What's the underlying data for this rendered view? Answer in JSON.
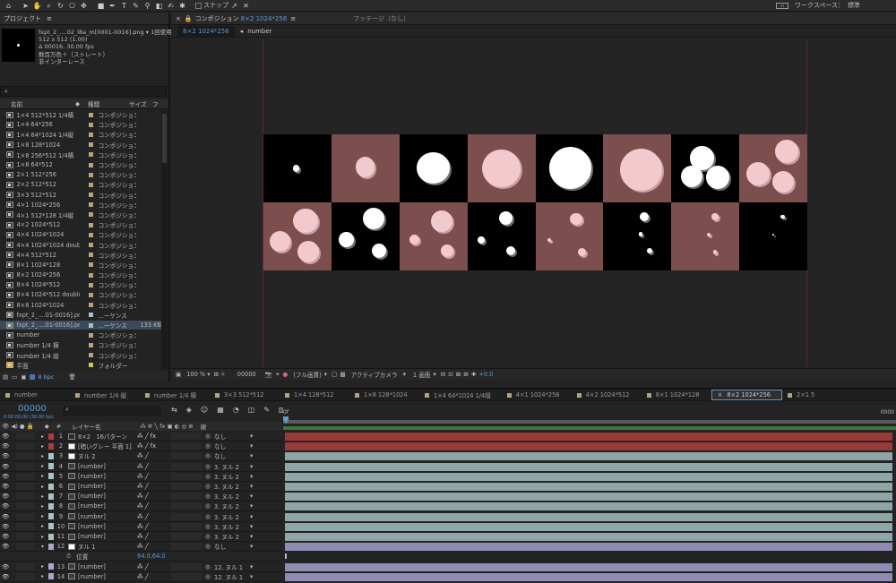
{
  "toolbar": {
    "snap_label": "スナップ",
    "workspace_label": "ワークスペース：",
    "workspace_value": "標準",
    "tools": [
      "home-icon",
      "select-icon",
      "hand-icon",
      "zoom-icon",
      "rotate-icon",
      "camera-icon",
      "pan-icon",
      "rect-icon",
      "pen-icon",
      "text-icon",
      "brush-icon",
      "stamp-icon",
      "eraser-icon",
      "roto-icon",
      "puppet-icon"
    ]
  },
  "project": {
    "tab_label": "プロジェクト",
    "preview": {
      "filename": "fxpt_2_....02_l8a_m[0001-0016].png ▾",
      "usage": "1回使用",
      "size": "512 x 512 (1.00)",
      "duration": "Δ 00016, 30.00 fps",
      "color": "数百万色＋（ストレート）",
      "interlace": "非インターレース"
    },
    "columns": {
      "name": "名前",
      "type": "種類",
      "size": "サイズ",
      "extra": "フ"
    },
    "items": [
      {
        "name": "1×4 512*512 1/4横",
        "type": "コンポジション",
        "size": "",
        "color": "#b8a37a",
        "icon": "comp"
      },
      {
        "name": "1×4 64*256",
        "type": "コンポジション",
        "size": "",
        "color": "#b8a37a",
        "icon": "comp"
      },
      {
        "name": "1×4 64*1024 1/4縦",
        "type": "コンポジション",
        "size": "",
        "color": "#b8a37a",
        "icon": "comp"
      },
      {
        "name": "1×8 128*1024",
        "type": "コンポジション",
        "size": "",
        "color": "#b8a37a",
        "icon": "comp"
      },
      {
        "name": "1×8 256*512 1/4横",
        "type": "コンポジション",
        "size": "",
        "color": "#b8a37a",
        "icon": "comp"
      },
      {
        "name": "1×8 64*512",
        "type": "コンポジション",
        "size": "",
        "color": "#b8a37a",
        "icon": "comp"
      },
      {
        "name": "2×1 512*256",
        "type": "コンポジション",
        "size": "",
        "color": "#b8a37a",
        "icon": "comp"
      },
      {
        "name": "2×2 512*512",
        "type": "コンポジション",
        "size": "",
        "color": "#b8a37a",
        "icon": "comp"
      },
      {
        "name": "3×3 512*512",
        "type": "コンポジション",
        "size": "",
        "color": "#b8a37a",
        "icon": "comp"
      },
      {
        "name": "4×1 1024*256",
        "type": "コンポジション",
        "size": "",
        "color": "#b8a37a",
        "icon": "comp"
      },
      {
        "name": "4×1 512*128 1/4縦",
        "type": "コンポジション",
        "size": "",
        "color": "#b8a37a",
        "icon": "comp"
      },
      {
        "name": "4×2 1024*512",
        "type": "コンポジション",
        "size": "",
        "color": "#b8a37a",
        "icon": "comp"
      },
      {
        "name": "4×4 1024*1024",
        "type": "コンポジション",
        "size": "",
        "color": "#b8a37a",
        "icon": "comp"
      },
      {
        "name": "4×4 1024*1024 double",
        "type": "コンポジション",
        "size": "",
        "color": "#b8a37a",
        "icon": "comp"
      },
      {
        "name": "4×4 512*512",
        "type": "コンポジション",
        "size": "",
        "color": "#b8a37a",
        "icon": "comp"
      },
      {
        "name": "8×1 1024*128",
        "type": "コンポジション",
        "size": "",
        "color": "#b8a37a",
        "icon": "comp"
      },
      {
        "name": "8×2 1024*256",
        "type": "コンポジション",
        "size": "",
        "color": "#b8a37a",
        "icon": "comp"
      },
      {
        "name": "8×4 1024*512",
        "type": "コンポジション",
        "size": "",
        "color": "#b8a37a",
        "icon": "comp"
      },
      {
        "name": "8×4 1024*512 double",
        "type": "コンポジション",
        "size": "",
        "color": "#b8a37a",
        "icon": "comp"
      },
      {
        "name": "8×8 1024*1024",
        "type": "コンポジション",
        "size": "",
        "color": "#b8a37a",
        "icon": "comp"
      },
      {
        "name": "fxpt_2_....01-0016].png",
        "type": "...ーケンス",
        "size": "",
        "color": "#9dc7c7",
        "icon": "seq"
      },
      {
        "name": "fxpt_2_....01-0016].png",
        "type": "...ーケンス",
        "size": "133 KB",
        "color": "#9dc7c7",
        "icon": "seq"
      },
      {
        "name": "number",
        "type": "コンポジション",
        "size": "",
        "color": "#b8a37a",
        "icon": "comp"
      },
      {
        "name": "number 1/4 横",
        "type": "コンポジション",
        "size": "",
        "color": "#b8a37a",
        "icon": "comp"
      },
      {
        "name": "number 1/4 縦",
        "type": "コンポジション",
        "size": "",
        "color": "#b8a37a",
        "icon": "comp"
      },
      {
        "name": "平面",
        "type": "フォルダー",
        "size": "",
        "color": "#d6c444",
        "icon": "folder"
      }
    ],
    "bpc": "8 bpc"
  },
  "comp": {
    "tab_label": "コンポジション",
    "tab_name": "8×2 1024*256",
    "footage_label": "フッテージ（なし）",
    "sub_tabs": [
      "8×2 1024*256",
      "number"
    ],
    "zoom": "100 %",
    "timecode": "00000",
    "quality": "(フル画質)",
    "camera": "アクティブカメラ",
    "views": "1 画面",
    "exposure": "+0.0"
  },
  "timeline": {
    "tabs": [
      "number",
      "number 1/4 縦",
      "number 1/4 横",
      "3×3 512*512",
      "1×4 128*512",
      "1×8 128*1024",
      "1×4 64*1024 1/4縦",
      "4×1 1024*256",
      "4×2 1024*512",
      "8×1 1024*128",
      "8×2 1024*256",
      "2×1 5"
    ],
    "active_tab": 10,
    "timecode": "00000",
    "timecode_sub": "0:00:00:00 (30.00 fps)",
    "col_layer_name": "レイヤー名",
    "col_parent": "親",
    "ruler_start": "0f",
    "ruler_end": "0000",
    "layers": [
      {
        "num": "1",
        "name": "8×2　16パターン",
        "parent": "なし",
        "label": "#b43a3a",
        "bar": "#9c3838",
        "fx": true
      },
      {
        "num": "2",
        "name": "[暗いグレー 平面 1]",
        "parent": "なし",
        "label": "#b43a3a",
        "bar": "#9c3838",
        "fx": true
      },
      {
        "num": "3",
        "name": "ヌル 2",
        "parent": "なし",
        "label": "#a9c4c4",
        "bar": "#8ea6a6",
        "fx": false
      },
      {
        "num": "4",
        "name": "[number]",
        "parent": "3. ヌル 2",
        "label": "#a9c4c4",
        "bar": "#8ea6a6",
        "fx": false
      },
      {
        "num": "5",
        "name": "[number]",
        "parent": "3. ヌル 2",
        "label": "#a9c4c4",
        "bar": "#8ea6a6",
        "fx": false
      },
      {
        "num": "6",
        "name": "[number]",
        "parent": "3. ヌル 2",
        "label": "#a9c4c4",
        "bar": "#8ea6a6",
        "fx": false
      },
      {
        "num": "7",
        "name": "[number]",
        "parent": "3. ヌル 2",
        "label": "#a9c4c4",
        "bar": "#8ea6a6",
        "fx": false
      },
      {
        "num": "8",
        "name": "[number]",
        "parent": "3. ヌル 2",
        "label": "#a9c4c4",
        "bar": "#8ea6a6",
        "fx": false
      },
      {
        "num": "9",
        "name": "[number]",
        "parent": "3. ヌル 2",
        "label": "#a9c4c4",
        "bar": "#8ea6a6",
        "fx": false
      },
      {
        "num": "10",
        "name": "[number]",
        "parent": "3. ヌル 2",
        "label": "#a9c4c4",
        "bar": "#8ea6a6",
        "fx": false
      },
      {
        "num": "11",
        "name": "[number]",
        "parent": "3. ヌル 2",
        "label": "#a9c4c4",
        "bar": "#8ea6a6",
        "fx": false
      },
      {
        "num": "12",
        "name": "ヌル 1",
        "parent": "なし",
        "label": "#a9a7d1",
        "bar": "#8f8db4",
        "fx": false
      },
      {
        "num": "",
        "name": "位置",
        "parent": "",
        "label": "",
        "bar": "",
        "fx": false,
        "value": "64.0,64.0"
      },
      {
        "num": "13",
        "name": "[number]",
        "parent": "12. ヌル 1",
        "label": "#a9a7d1",
        "bar": "#8f8db4",
        "fx": false
      },
      {
        "num": "14",
        "name": "[number]",
        "parent": "12. ヌル 1",
        "label": "#a9a7d1",
        "bar": "#8f8db4",
        "fx": false
      }
    ]
  }
}
